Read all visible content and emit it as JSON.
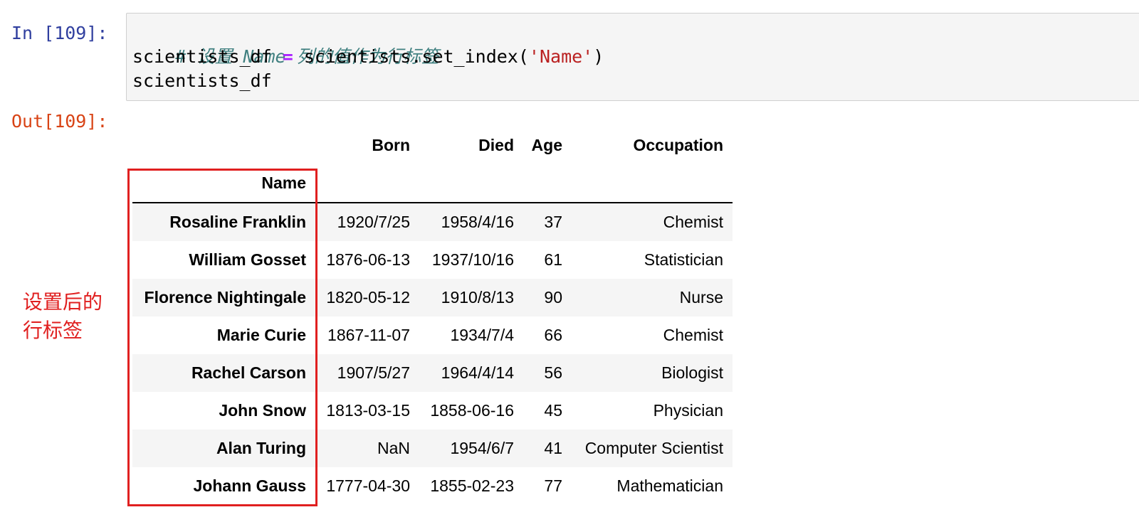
{
  "cell": {
    "in_prompt": "In [109]:",
    "out_prompt": "Out[109]:",
    "code": {
      "comment": "# 设置 Name 列的值作为行标签",
      "line2_var": "scientists_df ",
      "line2_op": "=",
      "line2_call": " scientists.set_index(",
      "line2_str": "'Name'",
      "line2_close": ")",
      "line3": "scientists_df"
    }
  },
  "dataframe": {
    "columns": [
      "Born",
      "Died",
      "Age",
      "Occupation"
    ],
    "index_name": "Name",
    "rows": [
      {
        "name": "Rosaline Franklin",
        "born": "1920/7/25",
        "died": "1958/4/16",
        "age": "37",
        "occupation": "Chemist"
      },
      {
        "name": "William Gosset",
        "born": "1876-06-13",
        "died": "1937/10/16",
        "age": "61",
        "occupation": "Statistician"
      },
      {
        "name": "Florence Nightingale",
        "born": "1820-05-12",
        "died": "1910/8/13",
        "age": "90",
        "occupation": "Nurse"
      },
      {
        "name": "Marie Curie",
        "born": "1867-11-07",
        "died": "1934/7/4",
        "age": "66",
        "occupation": "Chemist"
      },
      {
        "name": "Rachel Carson",
        "born": "1907/5/27",
        "died": "1964/4/14",
        "age": "56",
        "occupation": "Biologist"
      },
      {
        "name": "John Snow",
        "born": "1813-03-15",
        "died": "1858-06-16",
        "age": "45",
        "occupation": "Physician"
      },
      {
        "name": "Alan Turing",
        "born": "NaN",
        "died": "1954/6/7",
        "age": "41",
        "occupation": "Computer Scientist"
      },
      {
        "name": "Johann Gauss",
        "born": "1777-04-30",
        "died": "1855-02-23",
        "age": "77",
        "occupation": "Mathematician"
      }
    ]
  },
  "annotation": {
    "text": "设置后的行标签",
    "color": "#e02020"
  }
}
